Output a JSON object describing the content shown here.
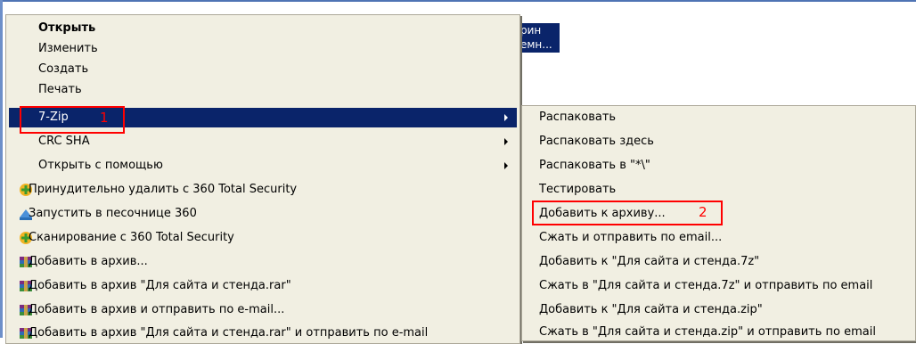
{
  "background_selection": [
    "рин",
    "емн..."
  ],
  "context_menu": {
    "items": [
      {
        "label": "Открыть",
        "bold": true
      },
      {
        "label": "Изменить"
      },
      {
        "label": "Создать"
      },
      {
        "label": "Печать"
      },
      {
        "label": "7-Zip",
        "submenu": true,
        "highlighted": true
      },
      {
        "label": "CRC SHA",
        "submenu": true
      },
      {
        "label": "Открыть с помощью",
        "submenu": true
      },
      {
        "label": "Принудительно удалить с  360 Total Security",
        "icon": "360-shield-icon"
      },
      {
        "label": "Запустить в песочнице 360",
        "icon": "sandbox-icon"
      },
      {
        "label": "Сканирование с 360 Total Security",
        "icon": "360-shield-icon"
      },
      {
        "label": "Добавить в архив...",
        "icon": "winrar-icon"
      },
      {
        "label": "Добавить в архив \"Для сайта и стенда.rar\"",
        "icon": "winrar-icon"
      },
      {
        "label": "Добавить в архив и отправить по e-mail...",
        "icon": "winrar-icon"
      },
      {
        "label": "Добавить в архив \"Для сайта и стенда.rar\" и отправить по e-mail",
        "icon": "winrar-icon"
      }
    ]
  },
  "submenu_7zip": {
    "items": [
      {
        "label": "Распаковать"
      },
      {
        "label": "Распаковать здесь"
      },
      {
        "label": "Распаковать в \"*\\\""
      },
      {
        "label": "Тестировать"
      },
      {
        "label": "Добавить к архиву..."
      },
      {
        "label": "Сжать и отправить по email..."
      },
      {
        "label": "Добавить к \"Для сайта и стенда.7z\""
      },
      {
        "label": "Сжать в \"Для сайта и стенда.7z\" и отправить по email"
      },
      {
        "label": "Добавить к \"Для сайта и стенда.zip\""
      },
      {
        "label": "Сжать в \"Для сайта и стенда.zip\" и отправить по email"
      }
    ]
  },
  "annotations": {
    "step1": "1",
    "step2": "2",
    "color": "#ff0000"
  },
  "colors": {
    "menu_bg": "#f1efe2",
    "highlight": "#0a246a"
  }
}
